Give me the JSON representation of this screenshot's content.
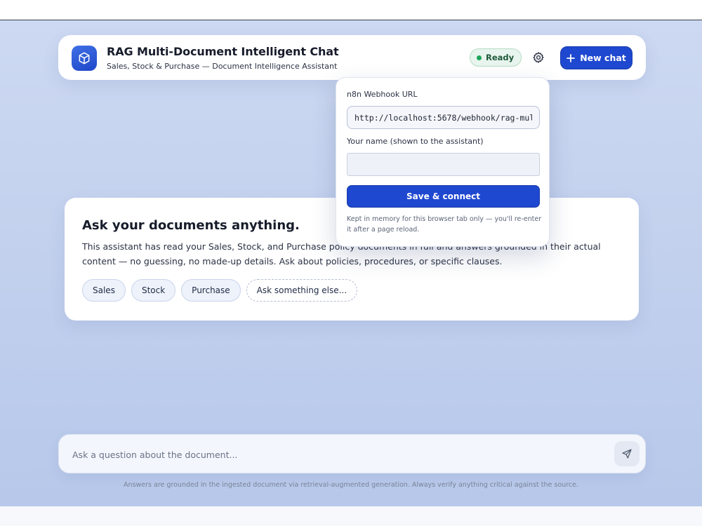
{
  "header": {
    "title": "RAG Multi-Document Intelligent Chat",
    "subtitle": "Sales, Stock & Purchase — Document Intelligence Assistant",
    "status": "Ready",
    "new_chat_label": "New chat",
    "logo_icon": "cube-icon",
    "settings_icon": "gear-icon"
  },
  "settings_popover": {
    "webhook_label": "n8n Webhook URL",
    "webhook_value": "http://localhost:5678/webhook/rag-mul",
    "name_label": "Your name (shown to the assistant)",
    "name_value": "",
    "save_label": "Save & connect",
    "note": "Kept in memory for this browser tab only — you'll re-enter it after a page reload."
  },
  "welcome": {
    "title": "Ask your documents anything.",
    "text": "This assistant has read your Sales, Stock, and Purchase policy documents in full and answers grounded in their actual content — no guessing, no made-up details. Ask about policies, procedures, or specific clauses.",
    "chips": [
      "Sales",
      "Stock",
      "Purchase",
      "Ask something else..."
    ]
  },
  "composer": {
    "placeholder": "Ask a question about the document...",
    "send_icon": "send-icon"
  },
  "footer": {
    "disclaimer": "Answers are grounded in the ingested document via retrieval-augmented generation. Always verify anything critical against the source."
  },
  "colors": {
    "accent": "#1f48d0",
    "status_green": "#1ea55a",
    "background": "#c3d1ee"
  }
}
